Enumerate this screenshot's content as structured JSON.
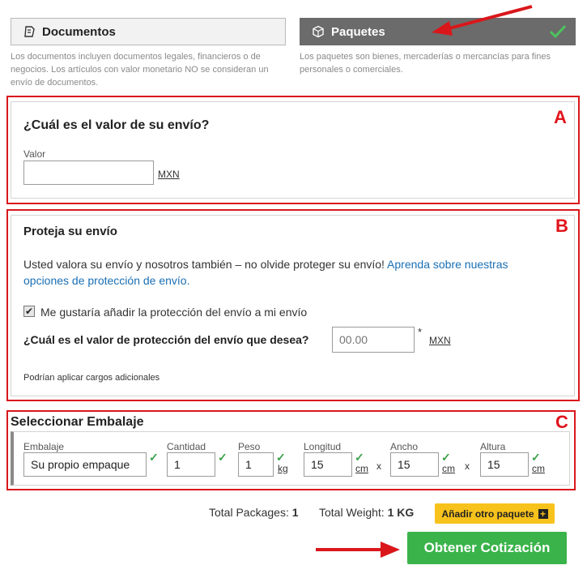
{
  "shipment_type": {
    "documents": {
      "label": "Documentos",
      "description": "Los documentos incluyen documentos legales, financieros o de negocios. Los artículos con valor monetario NO se consideran un envío de documentos."
    },
    "packages": {
      "label": "Paquetes",
      "description": "Los paquetes son bienes, mercaderías o mercancías para fines personales o comerciales."
    }
  },
  "section_a": {
    "marker": "A",
    "title": "¿Cuál es el valor de su envío?",
    "value_label": "Valor",
    "value": "",
    "currency": "MXN"
  },
  "section_b": {
    "marker": "B",
    "title": "Proteja su envío",
    "text": "Usted valora su envío y nosotros también – no olvide proteger su envío!",
    "link_text": "Aprenda sobre nuestras opciones de protección de envío.",
    "checkbox_label": "Me gustaría añadir la protección del envío a mi envío",
    "checkbox_checked": true,
    "protection_label": "¿Cuál es el valor de protección del envío que desea?",
    "protection_placeholder": "00.00",
    "required_mark": "*",
    "currency": "MXN",
    "note": "Podrían aplicar cargos adicionales"
  },
  "section_c": {
    "marker": "C",
    "title": "Seleccionar Embalaje",
    "fields": {
      "packaging": {
        "label": "Embalaje",
        "value": "Su propio empaque"
      },
      "quantity": {
        "label": "Cantidad",
        "value": "1"
      },
      "weight": {
        "label": "Peso",
        "value": "1",
        "unit": "kg"
      },
      "length": {
        "label": "Longitud",
        "value": "15",
        "unit": "cm"
      },
      "width": {
        "label": "Ancho",
        "value": "15",
        "unit": "cm"
      },
      "height": {
        "label": "Altura",
        "value": "15",
        "unit": "cm"
      }
    },
    "times_symbol": "x"
  },
  "summary": {
    "total_packages_label": "Total Packages:",
    "total_packages_value": "1",
    "total_weight_label": "Total Weight:",
    "total_weight_value": "1 KG"
  },
  "buttons": {
    "add_package": "Añadir otro paquete",
    "get_quote": "Obtener Cotización"
  },
  "colors": {
    "annotation_red": "#d9171b",
    "primary_green": "#3ab34a",
    "accent_yellow": "#f7c21c",
    "link_blue": "#1a6fb4"
  }
}
